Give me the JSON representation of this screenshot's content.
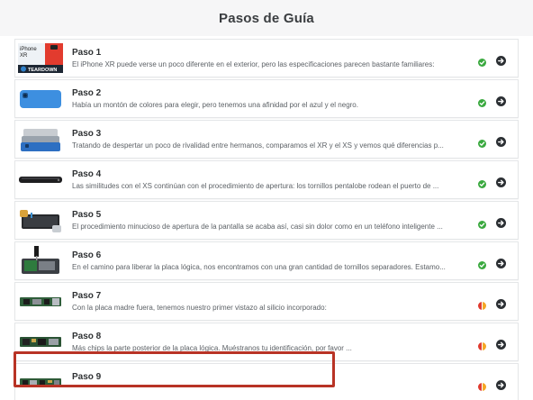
{
  "header": {
    "title": "Pasos de Guía"
  },
  "thumb_labels": {
    "iphone": "iPhone",
    "xr": "XR",
    "teardown": "TEARDOWN"
  },
  "steps": [
    {
      "title": "Paso 1",
      "description": "El iPhone XR puede verse un poco diferente en el exterior, pero las especificaciones parecen bastante familiares:",
      "status": "complete",
      "thumb": "iphone-xr-teardown-logo"
    },
    {
      "title": "Paso 2",
      "description": "Había un montón de colores para elegir, pero tenemos una afinidad por el azul y el negro.",
      "status": "complete",
      "thumb": "blue-iphone-back"
    },
    {
      "title": "Paso 3",
      "description": "Tratando de despertar un poco de rivalidad entre hermanos, comparamos el XR y el XS y vemos qué diferencias p...",
      "status": "complete",
      "thumb": "stacked-phones"
    },
    {
      "title": "Paso 4",
      "description": "Las similitudes con el XS continúan con el procedimiento de apertura: los tornillos pentalobe rodean el puerto de ...",
      "status": "complete",
      "thumb": "phone-side-edge"
    },
    {
      "title": "Paso 5",
      "description": "El procedimiento minucioso de apertura de la pantalla se acaba así, casi sin dolor como en un teléfono inteligente ...",
      "status": "complete",
      "thumb": "opening-screen-tools"
    },
    {
      "title": "Paso 6",
      "description": "En el camino para liberar la placa lógica, nos encontramos con una gran cantidad de tornillos separadores. Estamo...",
      "status": "complete",
      "thumb": "screwdriver-internals"
    },
    {
      "title": "Paso 7",
      "description": "Con la placa madre fuera, tenemos nuestro primer vistazo al silicio incorporado:",
      "status": "partial",
      "thumb": "logic-board"
    },
    {
      "title": "Paso 8",
      "description": "Más chips la parte posterior de la placa lógica. Muéstranos tu identificación, por favor ...",
      "status": "partial",
      "thumb": "logic-board-back"
    },
    {
      "title": "Paso 9",
      "description": "",
      "status": "partial",
      "thumb": "logic-board-chips"
    }
  ],
  "colors": {
    "complete": "#3aa93f",
    "partial_left": "#e03a2f",
    "partial_right": "#f5a623",
    "go": "#2b2f33",
    "highlight_border": "#b83325"
  }
}
